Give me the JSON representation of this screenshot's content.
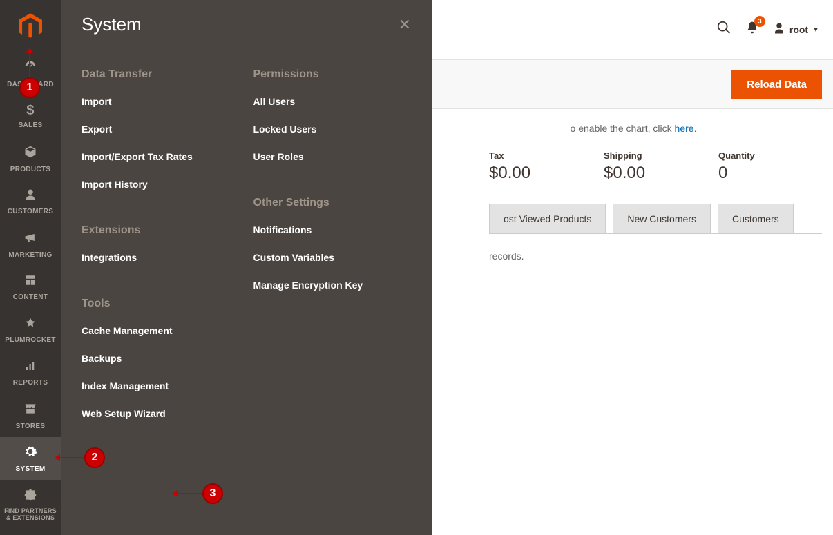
{
  "sidebar": {
    "items": [
      {
        "label": "DASHBOARD"
      },
      {
        "label": "SALES"
      },
      {
        "label": "PRODUCTS"
      },
      {
        "label": "CUSTOMERS"
      },
      {
        "label": "MARKETING"
      },
      {
        "label": "CONTENT"
      },
      {
        "label": "PLUMROCKET"
      },
      {
        "label": "REPORTS"
      },
      {
        "label": "STORES"
      },
      {
        "label": "SYSTEM"
      },
      {
        "label": "FIND PARTNERS & EXTENSIONS"
      }
    ]
  },
  "flyout": {
    "title": "System",
    "sections": {
      "data_transfer": {
        "head": "Data Transfer",
        "items": [
          "Import",
          "Export",
          "Import/Export Tax Rates",
          "Import History"
        ]
      },
      "extensions": {
        "head": "Extensions",
        "items": [
          "Integrations"
        ]
      },
      "tools": {
        "head": "Tools",
        "items": [
          "Cache Management",
          "Backups",
          "Index Management",
          "Web Setup Wizard"
        ]
      },
      "permissions": {
        "head": "Permissions",
        "items": [
          "All Users",
          "Locked Users",
          "User Roles"
        ]
      },
      "other": {
        "head": "Other Settings",
        "items": [
          "Notifications",
          "Custom Variables",
          "Manage Encryption Key"
        ]
      }
    }
  },
  "header": {
    "notification_count": "3",
    "username": "root"
  },
  "main": {
    "reload_button": "Reload Data",
    "chart_msg_prefix": "o enable the chart, click ",
    "chart_msg_link": "here",
    "chart_msg_suffix": ".",
    "stats": [
      {
        "label": "Tax",
        "value": "$0.00"
      },
      {
        "label": "Shipping",
        "value": "$0.00"
      },
      {
        "label": "Quantity",
        "value": "0"
      }
    ],
    "tabs": [
      "ost Viewed Products",
      "New Customers",
      "Customers"
    ],
    "records_msg": "records."
  },
  "annotations": [
    "1",
    "2",
    "3"
  ]
}
